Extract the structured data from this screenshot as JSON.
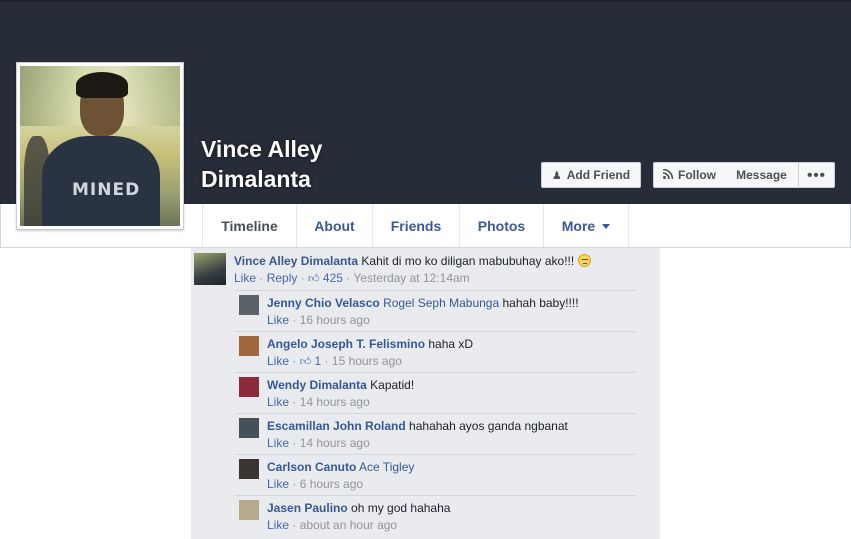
{
  "profile": {
    "first_name": "Vince Alley",
    "last_name": "Dimalanta",
    "picture_shirt_text": "MINED"
  },
  "actions": {
    "add_friend": "Add Friend",
    "follow": "Follow",
    "message": "Message",
    "more": "•••"
  },
  "tabs": [
    {
      "label": "Timeline"
    },
    {
      "label": "About"
    },
    {
      "label": "Friends"
    },
    {
      "label": "Photos"
    },
    {
      "label": "More"
    }
  ],
  "post": {
    "author": "Vince Alley Dimalanta",
    "text": "Kahit di mo ko diligan mabubuhay ako!!!",
    "like": "Like",
    "reply": "Reply",
    "likes": "425",
    "time": "Yesterday at 12:14am"
  },
  "replies": [
    {
      "author": "Jenny Chio Velasco",
      "tag": "Rogel Seph Mabunga",
      "text": "hahah baby!!!!",
      "like": "Like",
      "likes": "",
      "time": "16 hours ago",
      "avatar_color": "#5d6168"
    },
    {
      "author": "Angelo Joseph T. Felismino",
      "tag": "",
      "text": "haha xD",
      "like": "Like",
      "likes": "1",
      "time": "15 hours ago",
      "avatar_color": "#a0683c"
    },
    {
      "author": "Wendy Dimalanta",
      "tag": "",
      "text": "Kapatid!",
      "like": "Like",
      "likes": "",
      "time": "14 hours ago",
      "avatar_color": "#8a2a3a"
    },
    {
      "author": "Escamillan John Roland",
      "tag": "",
      "text": "hahahah ayos ganda ngbanat",
      "like": "Like",
      "likes": "",
      "time": "14 hours ago",
      "avatar_color": "#46505a"
    },
    {
      "author": "Carlson Canuto",
      "tag": "Ace Tigley",
      "text": "",
      "like": "Like",
      "likes": "",
      "time": "6 hours ago",
      "avatar_color": "#3a3530"
    },
    {
      "author": "Jasen Paulino",
      "tag": "",
      "text": "oh my god hahaha",
      "like": "Like",
      "likes": "",
      "time": "about an hour ago",
      "avatar_color": "#b8a98c"
    }
  ]
}
